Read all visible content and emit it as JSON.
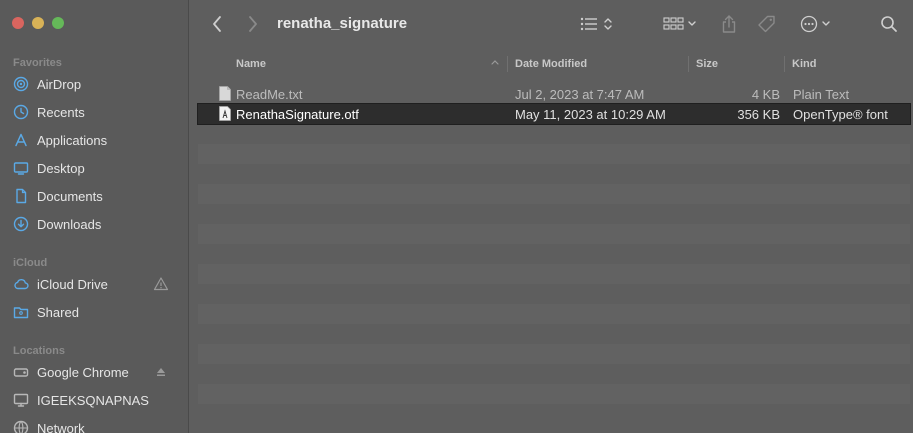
{
  "window": {
    "title": "renatha_signature"
  },
  "sidebar": {
    "favorites_title": "Favorites",
    "favorites": [
      {
        "label": "AirDrop",
        "icon": "airdrop-icon"
      },
      {
        "label": "Recents",
        "icon": "clock-icon"
      },
      {
        "label": "Applications",
        "icon": "applications-icon"
      },
      {
        "label": "Desktop",
        "icon": "desktop-icon"
      },
      {
        "label": "Documents",
        "icon": "document-icon"
      },
      {
        "label": "Downloads",
        "icon": "download-icon"
      }
    ],
    "icloud_title": "iCloud",
    "icloud": [
      {
        "label": "iCloud Drive",
        "icon": "cloud-icon"
      },
      {
        "label": "Shared",
        "icon": "shared-folder-icon"
      }
    ],
    "locations_title": "Locations",
    "locations": [
      {
        "label": "Google Chrome",
        "icon": "drive-icon"
      },
      {
        "label": "IGEEKSQNAPNAS",
        "icon": "monitor-icon"
      },
      {
        "label": "Network",
        "icon": "network-icon"
      }
    ]
  },
  "columns": {
    "name": "Name",
    "date": "Date Modified",
    "size": "Size",
    "kind": "Kind"
  },
  "files": [
    {
      "name": "ReadMe.txt",
      "date": "Jul 2, 2023 at 7:47 AM",
      "size": "4 KB",
      "kind": "Plain Text"
    },
    {
      "name": "RenathaSignature.otf",
      "date": "May 11, 2023 at 10:29 AM",
      "size": "356 KB",
      "kind": "OpenType® font"
    }
  ],
  "colors": {
    "accent": "#5aa9e6",
    "selected_row": "#2d2d2d"
  }
}
